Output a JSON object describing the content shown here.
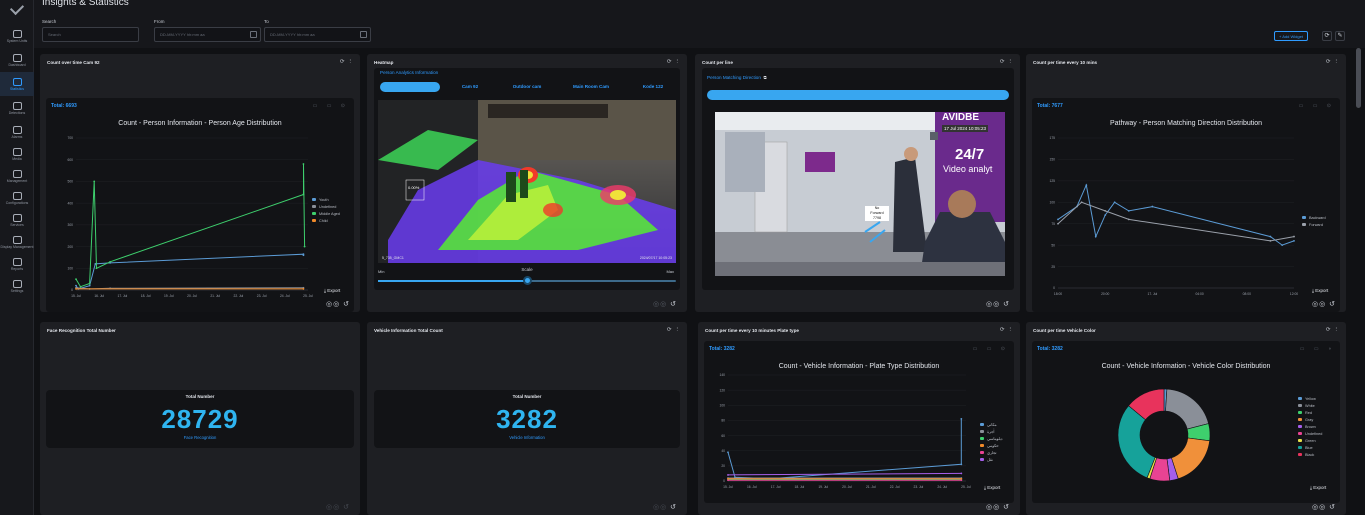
{
  "page": {
    "title": "Insights & Statistics"
  },
  "sidebar": {
    "items": [
      {
        "label": "System Units",
        "icon": "system-units-icon",
        "active": false
      },
      {
        "label": "Dashboard",
        "icon": "dashboard-icon",
        "active": false
      },
      {
        "label": "Statistics",
        "icon": "statistics-icon",
        "active": true
      },
      {
        "label": "Detections",
        "icon": "detections-icon",
        "active": false
      },
      {
        "label": "Alarms",
        "icon": "alarm-icon",
        "active": false
      },
      {
        "label": "Media",
        "icon": "media-icon",
        "active": false
      },
      {
        "label": "Management",
        "icon": "management-icon",
        "active": false
      },
      {
        "label": "Configurations",
        "icon": "configurations-icon",
        "active": false
      },
      {
        "label": "Services",
        "icon": "services-icon",
        "active": false
      },
      {
        "label": "Display Management",
        "icon": "display-icon",
        "active": false
      },
      {
        "label": "Reports",
        "icon": "reports-icon",
        "active": false
      },
      {
        "label": "Settings",
        "icon": "settings-icon",
        "active": false
      }
    ]
  },
  "filters": {
    "search_label": "Search",
    "search_placeholder": "Search",
    "from_label": "From",
    "from_placeholder": "DD-MM-YYYY hh:mm aa",
    "to_label": "To",
    "to_placeholder": "DD-MM-YYYY hh:mm aa"
  },
  "toolbar": {
    "add_widget": "+ Add Widget",
    "refresh": "⟳",
    "edit": "✎"
  },
  "widgets": {
    "w1": {
      "title": "Count over time Cam 92",
      "total": "Total: 6693",
      "chart_title": "Count - Person Information - Person Age Distribution",
      "export": "Export"
    },
    "w2": {
      "title": "Heatmap",
      "tab_header": "Person Analytics Information",
      "tabs": [
        "",
        "Cam 92",
        "Outdoor cam",
        "Main Room Cam",
        "Kode 122"
      ],
      "overlay_pct": "0.00%",
      "cam_id": "5_735_GMC1",
      "cam_date": "2024/07/17 10:05:23",
      "slider_min": "Min",
      "slider_label": "Scale",
      "slider_max": "Max",
      "slider_value": 0.5
    },
    "w3": {
      "title": "Count per line",
      "sub_label": "Person Matching Direction",
      "banner": "24/7",
      "banner_sub": "Video analyt",
      "brand": "AVIDBE",
      "date_overlay": "17 Jul 2024   10:05:23",
      "tag_top": "No",
      "tag_mid": "Forward",
      "tag_bot": "7798"
    },
    "w4": {
      "title": "Count per time every 10 mins",
      "total": "Total: 7677",
      "chart_title": "Pathway - Person Matching Direction Distribution",
      "export": "Export"
    },
    "w5": {
      "title": "Face Recognition Total Number",
      "label": "Total Number",
      "value": "28729",
      "sub": "Face Recognition"
    },
    "w6": {
      "title": "Vehicle Information Total Count",
      "label": "Total Number",
      "value": "3282",
      "sub": "Vehicle Information"
    },
    "w7": {
      "title": "Count per time every 10 minutes Plate type",
      "total": "Total: 3282",
      "chart_title": "Count - Vehicle Information - Plate Type Distribution",
      "export": "Export"
    },
    "w8": {
      "title": "Count per time Vehicle Color",
      "total": "Total: 3282",
      "chart_title": "Count - Vehicle Information - Vehicle Color Distribution",
      "export": "Export"
    }
  },
  "colors": {
    "accent": "#2f9bff",
    "panel": "#1e1f23",
    "card": "#121316",
    "background": "#101114"
  },
  "chart_data": [
    {
      "type": "line",
      "title": "Count - Person Information - Person Age Distribution",
      "x": [
        "15. Jul",
        "16. Jul",
        "17. Jul",
        "18. Jul",
        "19. Jul",
        "20. Jul",
        "21. Jul",
        "22. Jul",
        "23. Jul",
        "24. Jul",
        "25. Jul"
      ],
      "ylim": [
        0,
        700
      ],
      "yticks": [
        0,
        100,
        200,
        300,
        400,
        500,
        600,
        700
      ],
      "series": [
        {
          "name": "Youth",
          "color": "#5b9bd5",
          "points": [
            [
              0.0,
              20
            ],
            [
              0.1,
              5
            ],
            [
              0.6,
              20
            ],
            [
              0.85,
              120
            ],
            [
              1.5,
              125
            ],
            [
              10.0,
              165
            ],
            [
              10.0,
              160
            ]
          ]
        },
        {
          "name": "Undefined",
          "color": "#8a8f98",
          "points": [
            [
              0.0,
              10
            ],
            [
              0.6,
              5
            ],
            [
              1.5,
              8
            ],
            [
              10.0,
              10
            ]
          ]
        },
        {
          "name": "Middle Aged",
          "color": "#3ecf6d",
          "points": [
            [
              0.0,
              50
            ],
            [
              0.2,
              15
            ],
            [
              0.6,
              30
            ],
            [
              0.8,
              500
            ],
            [
              0.9,
              100
            ],
            [
              1.5,
              130
            ],
            [
              10.0,
              440
            ],
            [
              10.0,
              580
            ],
            [
              10.05,
              200
            ]
          ]
        },
        {
          "name": "Child",
          "color": "#f08a2a",
          "points": [
            [
              0.0,
              5
            ],
            [
              10.0,
              5
            ]
          ]
        }
      ],
      "legend": "right"
    },
    {
      "type": "line",
      "title": "Pathway - Person Matching Direction Distribution",
      "x": [
        "18:00",
        "20:00",
        "17. Jul",
        "04:00",
        "08:00",
        "12:00"
      ],
      "ylim": [
        0,
        175
      ],
      "yticks": [
        0,
        25,
        50,
        75,
        100,
        125,
        150,
        175
      ],
      "series": [
        {
          "name": "Backward",
          "color": "#5b9bd5",
          "points": [
            [
              0.0,
              80
            ],
            [
              0.08,
              95
            ],
            [
              0.12,
              120
            ],
            [
              0.16,
              60
            ],
            [
              0.2,
              85
            ],
            [
              0.24,
              100
            ],
            [
              0.3,
              90
            ],
            [
              0.4,
              95
            ],
            [
              0.9,
              60
            ],
            [
              0.95,
              50
            ],
            [
              1.0,
              55
            ]
          ]
        },
        {
          "name": "Forward",
          "color": "#9aa0aa",
          "points": [
            [
              0.0,
              75
            ],
            [
              0.1,
              100
            ],
            [
              0.2,
              90
            ],
            [
              0.3,
              80
            ],
            [
              0.9,
              55
            ],
            [
              1.0,
              60
            ]
          ]
        }
      ],
      "legend": "right"
    },
    {
      "type": "line",
      "title": "Count - Vehicle Information - Plate Type Distribution",
      "x": [
        "15. Jul",
        "16. Jul",
        "17. Jul",
        "18. Jul",
        "19. Jul",
        "20. Jul",
        "21. Jul",
        "22. Jul",
        "23. Jul",
        "24. Jul",
        "25. Jul"
      ],
      "ylim": [
        0,
        140
      ],
      "yticks": [
        0,
        20,
        40,
        60,
        80,
        100,
        120,
        140
      ],
      "series": [
        {
          "name": "مكاني",
          "color": "#5b9bd5",
          "points": [
            [
              0.0,
              38
            ],
            [
              0.3,
              5
            ],
            [
              1.8,
              3
            ],
            [
              10.0,
              22
            ],
            [
              10.0,
              82
            ]
          ]
        },
        {
          "name": "أجرة",
          "color": "#8a8f98",
          "points": [
            [
              0.0,
              4
            ],
            [
              10.0,
              4
            ]
          ]
        },
        {
          "name": "دبلوماسي",
          "color": "#3ecf6d",
          "points": [
            [
              0.0,
              2
            ],
            [
              10.0,
              2
            ]
          ]
        },
        {
          "name": "حكومي",
          "color": "#f08a2a",
          "points": [
            [
              0.0,
              3
            ],
            [
              10.0,
              3
            ]
          ]
        },
        {
          "name": "تجاري",
          "color": "#e84393",
          "points": [
            [
              0.0,
              1
            ],
            [
              10.0,
              1
            ]
          ]
        },
        {
          "name": "نقل",
          "color": "#a55eea",
          "points": [
            [
              0.0,
              8
            ],
            [
              10.0,
              10
            ]
          ]
        }
      ],
      "legend": "right"
    },
    {
      "type": "pie",
      "title": "Count - Vehicle Information - Vehicle Color Distribution",
      "legend": "right",
      "slices": [
        {
          "name": "Yellow",
          "color": "#5b9bd5",
          "value": 1
        },
        {
          "name": "White",
          "color": "#8a8f98",
          "value": 20
        },
        {
          "name": "Red",
          "color": "#3ecf6d",
          "value": 6
        },
        {
          "name": "Gray",
          "color": "#f0903a",
          "value": 18
        },
        {
          "name": "Brown",
          "color": "#a55eea",
          "value": 3
        },
        {
          "name": "Undefined",
          "color": "#e84393",
          "value": 7
        },
        {
          "name": "Green",
          "color": "#e6e24a",
          "value": 1
        },
        {
          "name": "Blue",
          "color": "#16a29a",
          "value": 30
        },
        {
          "name": "Black",
          "color": "#e8335c",
          "value": 14
        }
      ]
    }
  ]
}
